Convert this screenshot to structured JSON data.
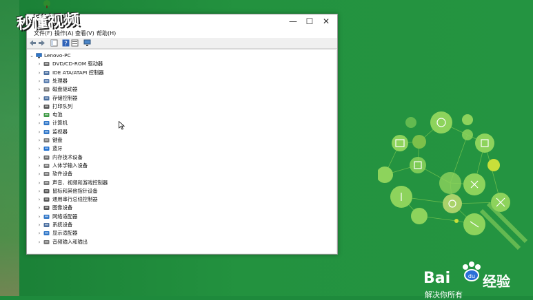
{
  "overlay": {
    "logo_text": "秒懂视频"
  },
  "window": {
    "menu": [
      {
        "label": "文件(F)"
      },
      {
        "label": "操作(A)"
      },
      {
        "label": "查看(V)"
      },
      {
        "label": "帮助(H)"
      }
    ],
    "controls": {
      "minimize": "—",
      "maximize": "☐",
      "close": "✕"
    }
  },
  "tree": {
    "root": "Lenovo-PC",
    "items": [
      {
        "label": "DVD/CD-ROM 驱动器",
        "icon": "dvd-drive-icon",
        "color": "#6a6a6a"
      },
      {
        "label": "IDE ATA/ATAPI 控制器",
        "icon": "ide-controller-icon",
        "color": "#4a6fa0"
      },
      {
        "label": "处理器",
        "icon": "processor-icon",
        "color": "#5b7fb0"
      },
      {
        "label": "磁盘驱动器",
        "icon": "disk-drive-icon",
        "color": "#7a7a7a"
      },
      {
        "label": "存储控制器",
        "icon": "storage-controller-icon",
        "color": "#4a6fa0"
      },
      {
        "label": "打印队列",
        "icon": "printer-icon",
        "color": "#555555"
      },
      {
        "label": "电池",
        "icon": "battery-icon",
        "color": "#3e9a45"
      },
      {
        "label": "计算机",
        "icon": "computer-icon",
        "color": "#2f76c8"
      },
      {
        "label": "监视器",
        "icon": "monitor-icon",
        "color": "#2f76c8"
      },
      {
        "label": "键盘",
        "icon": "keyboard-icon",
        "color": "#777777"
      },
      {
        "label": "蓝牙",
        "icon": "bluetooth-icon",
        "color": "#1e6fd0"
      },
      {
        "label": "内存技术设备",
        "icon": "memory-device-icon",
        "color": "#6a6a6a"
      },
      {
        "label": "人体学输入设备",
        "icon": "hid-icon",
        "color": "#777777"
      },
      {
        "label": "软件设备",
        "icon": "software-device-icon",
        "color": "#777777"
      },
      {
        "label": "声音、视频和游戏控制器",
        "icon": "audio-icon",
        "color": "#777777"
      },
      {
        "label": "鼠标和其他指针设备",
        "icon": "mouse-icon",
        "color": "#555555"
      },
      {
        "label": "通用串行总线控制器",
        "icon": "usb-icon",
        "color": "#555555"
      },
      {
        "label": "图像设备",
        "icon": "imaging-device-icon",
        "color": "#555555"
      },
      {
        "label": "网络适配器",
        "icon": "network-adapter-icon",
        "color": "#2f76c8"
      },
      {
        "label": "系统设备",
        "icon": "system-device-icon",
        "color": "#4a6fa0"
      },
      {
        "label": "显示适配器",
        "icon": "display-adapter-icon",
        "color": "#2f76c8"
      },
      {
        "label": "音频输入和输出",
        "icon": "audio-io-icon",
        "color": "#777777"
      }
    ]
  },
  "brand": {
    "baidu": "Bai",
    "du": "du",
    "jingyan": "经验",
    "slogan": "解决你所有"
  },
  "colors": {
    "accent_green": "#8dd35c",
    "desktop_green": "#1e8a3c"
  }
}
